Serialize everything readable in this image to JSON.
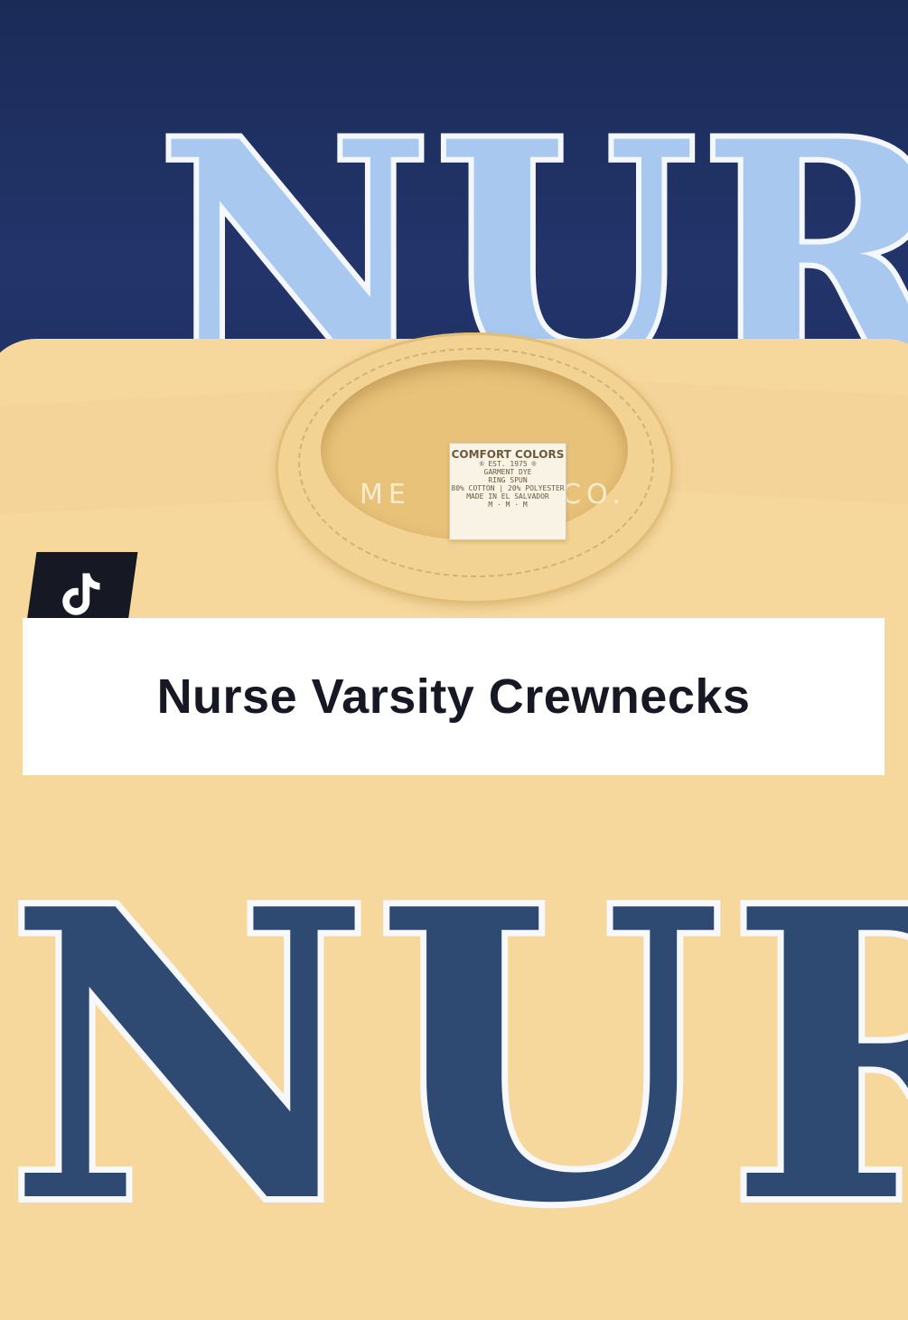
{
  "photo": {
    "navy_shirt": {
      "color": "#1e2f5e",
      "print_text": "NURSE",
      "print_color": "#a9c8ef"
    },
    "yellow_shirt": {
      "color": "#f6d79c",
      "print_text": "NURSE",
      "print_color": "#2f4a72",
      "brand_left": "ME",
      "brand_right": "CO.",
      "neck_label": {
        "brand": "COMFORT COLORS",
        "line1": "® EST. 1975 ®",
        "line2": "GARMENT DYE",
        "line3": "RING SPUN",
        "line4": "80% COTTON | 20% POLYESTER",
        "line5": "MADE IN EL SALVADOR",
        "size": "M · M · M"
      }
    }
  },
  "overlay": {
    "platform_icon": "tiktok-icon",
    "caption": "Nurse Varsity Crewnecks"
  }
}
